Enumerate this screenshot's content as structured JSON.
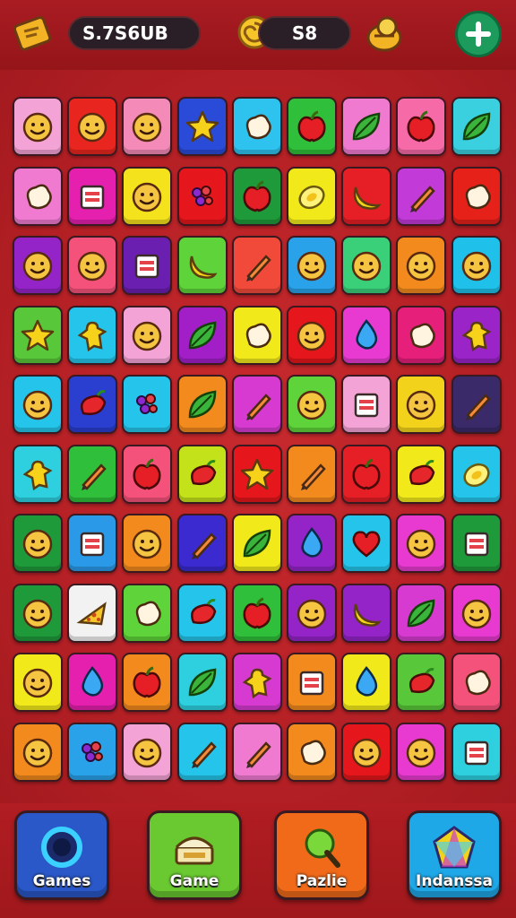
{
  "header": {
    "coins_value": "S.7S6UB",
    "lives_value": "S8",
    "icons": [
      "map-icon",
      "swirl-coin-icon",
      "gold-coins-icon",
      "plus-icon"
    ],
    "colors": {
      "bar": "#a91c22",
      "pill": "#2a1f26",
      "plus": "#1d9b5c"
    }
  },
  "board": {
    "rows": [
      [
        {
          "icon": "face",
          "color": "#f4a3d6"
        },
        {
          "icon": "face",
          "color": "#e8261f"
        },
        {
          "icon": "face",
          "color": "#f48ab8"
        },
        {
          "icon": "star",
          "color": "#2a4bd8"
        },
        {
          "icon": "blob",
          "color": "#2ec2ee"
        },
        {
          "icon": "apple",
          "color": "#2fbf3a"
        },
        {
          "icon": "leaf",
          "color": "#f07ad0"
        },
        {
          "icon": "apple",
          "color": "#f66aa8"
        },
        {
          "icon": "leaf",
          "color": "#3ad0e0"
        }
      ],
      [
        {
          "icon": "blob",
          "color": "#f07ad0"
        },
        {
          "icon": "box",
          "color": "#e51fae"
        },
        {
          "icon": "face",
          "color": "#f4e21d"
        },
        {
          "icon": "berry",
          "color": "#e5171c"
        },
        {
          "icon": "apple",
          "color": "#1f9a3a"
        },
        {
          "icon": "lemon",
          "color": "#f2e91a"
        },
        {
          "icon": "banana",
          "color": "#e51f25"
        },
        {
          "icon": "pencil",
          "color": "#c23ad8"
        },
        {
          "icon": "blob",
          "color": "#e52119"
        }
      ],
      [
        {
          "icon": "face",
          "color": "#9424c8"
        },
        {
          "icon": "face",
          "color": "#f4527a"
        },
        {
          "icon": "box",
          "color": "#6a1fb0"
        },
        {
          "icon": "banana",
          "color": "#5fd43a"
        },
        {
          "icon": "pencil",
          "color": "#f24a3a"
        },
        {
          "icon": "face",
          "color": "#2aa2ea"
        },
        {
          "icon": "face",
          "color": "#3ad07a"
        },
        {
          "icon": "face",
          "color": "#f28a1d"
        },
        {
          "icon": "face",
          "color": "#1fc0ea"
        }
      ],
      [
        {
          "icon": "star",
          "color": "#58c83a"
        },
        {
          "icon": "man",
          "color": "#25c4ea"
        },
        {
          "icon": "face",
          "color": "#f4a3d6"
        },
        {
          "icon": "leaf",
          "color": "#a21fc8"
        },
        {
          "icon": "blob",
          "color": "#f2e91a"
        },
        {
          "icon": "face",
          "color": "#e5171c"
        },
        {
          "icon": "drop",
          "color": "#e83ad0"
        },
        {
          "icon": "blob",
          "color": "#e51f7a"
        },
        {
          "icon": "man",
          "color": "#9a24c8"
        }
      ],
      [
        {
          "icon": "face",
          "color": "#25c4ea"
        },
        {
          "icon": "pepper",
          "color": "#2a3ed0"
        },
        {
          "icon": "berry",
          "color": "#25c4ea"
        },
        {
          "icon": "leaf",
          "color": "#f28a1d"
        },
        {
          "icon": "pencil",
          "color": "#d73ad0"
        },
        {
          "icon": "face",
          "color": "#5fd43a"
        },
        {
          "icon": "box",
          "color": "#f4a3d6"
        },
        {
          "icon": "face",
          "color": "#f2d21a"
        },
        {
          "icon": "pencil",
          "color": "#3a2a6a"
        }
      ],
      [
        {
          "icon": "man",
          "color": "#2ed0e0"
        },
        {
          "icon": "pencil",
          "color": "#2fbf3a"
        },
        {
          "icon": "apple",
          "color": "#f4527a"
        },
        {
          "icon": "pepper",
          "color": "#c4e21a"
        },
        {
          "icon": "star",
          "color": "#e5171c"
        },
        {
          "icon": "pencil",
          "color": "#f28a1d"
        },
        {
          "icon": "apple",
          "color": "#e51f25"
        },
        {
          "icon": "pepper",
          "color": "#f2e91a"
        },
        {
          "icon": "lemon",
          "color": "#25c4ea"
        }
      ],
      [
        {
          "icon": "face",
          "color": "#1f9a3a"
        },
        {
          "icon": "box",
          "color": "#2a9ae8"
        },
        {
          "icon": "face",
          "color": "#f28a1d"
        },
        {
          "icon": "pencil",
          "color": "#3a2ad0"
        },
        {
          "icon": "leaf",
          "color": "#f2e91a"
        },
        {
          "icon": "drop",
          "color": "#9424c8"
        },
        {
          "icon": "heart",
          "color": "#25c4ea"
        },
        {
          "icon": "face",
          "color": "#e83ad0"
        },
        {
          "icon": "box",
          "color": "#1f9a3a"
        }
      ],
      [
        {
          "icon": "face",
          "color": "#1f9a3a"
        },
        {
          "icon": "cheese",
          "color": "#f2f2f2"
        },
        {
          "icon": "blob",
          "color": "#5fd43a"
        },
        {
          "icon": "pepper",
          "color": "#25c4ea"
        },
        {
          "icon": "apple",
          "color": "#2fbf3a"
        },
        {
          "icon": "face",
          "color": "#9424c8"
        },
        {
          "icon": "banana",
          "color": "#9424c8"
        },
        {
          "icon": "leaf",
          "color": "#d73ad0"
        },
        {
          "icon": "face",
          "color": "#e83ad0"
        }
      ],
      [
        {
          "icon": "face",
          "color": "#f2e91a"
        },
        {
          "icon": "drop",
          "color": "#e51fae"
        },
        {
          "icon": "apple",
          "color": "#f28a1d"
        },
        {
          "icon": "leaf",
          "color": "#2ed0e0"
        },
        {
          "icon": "man",
          "color": "#d73ad0"
        },
        {
          "icon": "box",
          "color": "#f28a1d"
        },
        {
          "icon": "drop",
          "color": "#f2e91a"
        },
        {
          "icon": "pepper",
          "color": "#58c83a"
        },
        {
          "icon": "blob",
          "color": "#f4527a"
        }
      ],
      [
        {
          "icon": "face",
          "color": "#f28a1d"
        },
        {
          "icon": "berry",
          "color": "#2aa2ea"
        },
        {
          "icon": "face",
          "color": "#f4a3d6"
        },
        {
          "icon": "pencil",
          "color": "#25c4ea"
        },
        {
          "icon": "pencil",
          "color": "#f07ad0"
        },
        {
          "icon": "blob",
          "color": "#f28a1d"
        },
        {
          "icon": "face",
          "color": "#e5171c"
        },
        {
          "icon": "face",
          "color": "#e83ad0"
        },
        {
          "icon": "box",
          "color": "#2ed0e0"
        }
      ]
    ]
  },
  "nav": [
    {
      "label": "Games",
      "icon": "portal-icon",
      "color": "#2a58c8"
    },
    {
      "label": "Game",
      "icon": "cake-icon",
      "color": "#6ac830"
    },
    {
      "label": "Pazlie",
      "icon": "magnifier-icon",
      "color": "#f06a1a"
    },
    {
      "label": "Indanssa",
      "icon": "gem-icon",
      "color": "#1fa8e8"
    }
  ]
}
